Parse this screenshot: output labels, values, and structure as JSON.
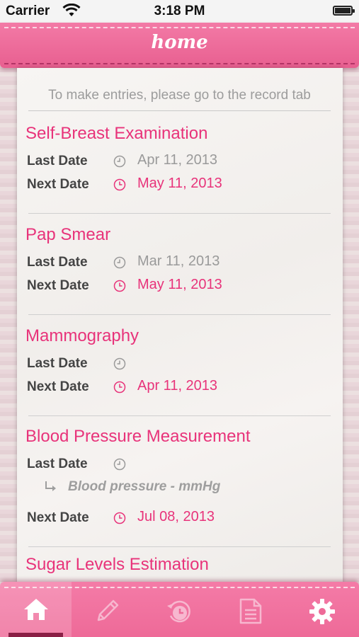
{
  "status_bar": {
    "carrier": "Carrier",
    "time": "3:18 PM"
  },
  "nav": {
    "title": "home"
  },
  "hint": "To make entries, please go to the record tab",
  "labels": {
    "last_date": "Last Date",
    "next_date": "Next Date"
  },
  "entries": [
    {
      "name": "Self-Breast Examination",
      "last": "Apr 11, 2013",
      "next": "May 11, 2013"
    },
    {
      "name": "Pap Smear",
      "last": "Mar 11, 2013",
      "next": "May 11, 2013"
    },
    {
      "name": "Mammography",
      "last": "",
      "next": "Apr 11, 2013"
    },
    {
      "name": "Blood Pressure Measurement",
      "last": "",
      "sub": "Blood pressure -  mmHg",
      "next": "Jul 08, 2013"
    },
    {
      "name": "Sugar Levels Estimation"
    }
  ],
  "tabs": [
    {
      "icon": "home-icon",
      "active": true
    },
    {
      "icon": "pencil-icon",
      "active": false
    },
    {
      "icon": "history-clock-icon",
      "active": false
    },
    {
      "icon": "document-icon",
      "active": false
    },
    {
      "icon": "gear-icon",
      "active": false
    }
  ],
  "colors": {
    "brand_pink": "#e8337a",
    "nav_pink": "#ee6a98",
    "active_tab_indicator": "#8a1f45"
  }
}
